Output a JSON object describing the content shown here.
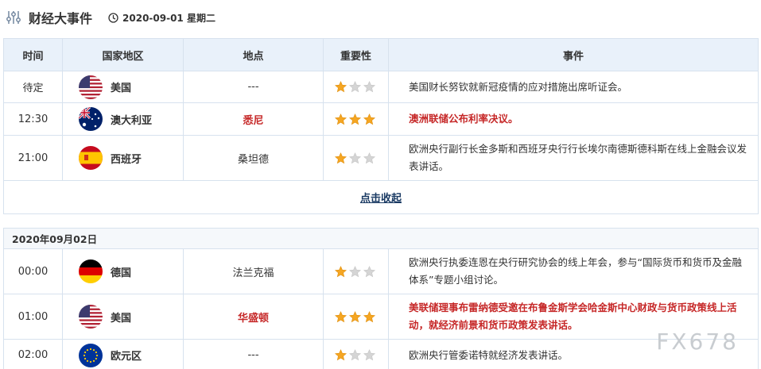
{
  "header": {
    "title": "财经大事件",
    "date": "2020-09-01 星期二"
  },
  "columns": [
    "时间",
    "国家地区",
    "地点",
    "重要性",
    "事件"
  ],
  "day1": [
    {
      "time": "待定",
      "country": "美国",
      "flag": "us-flag-icon",
      "place": "---",
      "importance": 1,
      "event": "美国财长努钦就新冠疫情的应对措施出席听证会。",
      "important": false
    },
    {
      "time": "12:30",
      "country": "澳大利亚",
      "flag": "au-flag-icon",
      "place": "悉尼",
      "importance": 3,
      "event": "澳洲联储公布利率决议。",
      "important": true
    },
    {
      "time": "21:00",
      "country": "西班牙",
      "flag": "es-flag-icon",
      "place": "桑坦德",
      "importance": 1,
      "event": "欧洲央行副行长金多斯和西班牙央行行长埃尔南德斯德科斯在线上金融会议发表讲话。",
      "important": false
    }
  ],
  "collapse_label": "点击收起",
  "day2_label": "2020年09月02日",
  "day2": [
    {
      "time": "00:00",
      "country": "德国",
      "flag": "de-flag-icon",
      "place": "法兰克福",
      "importance": 1,
      "event": "欧洲央行执委连恩在央行研究协会的线上年会，参与“国际货币和货币及金融体系”专题小组讨论。",
      "important": false
    },
    {
      "time": "01:00",
      "country": "美国",
      "flag": "us-flag-icon",
      "place": "华盛顿",
      "importance": 3,
      "event": "美联储理事布雷纳德受邀在布鲁金斯学会哈金斯中心财政与货币政策线上活动，就经济前景和货币政策发表讲话。",
      "important": true
    },
    {
      "time": "02:00",
      "country": "欧元区",
      "flag": "eu-flag-icon",
      "place": "---",
      "importance": 1,
      "event": "欧洲央行管委诺特就经济发表讲话。",
      "important": false
    }
  ],
  "watermark": "FX678",
  "colors": {
    "important": "#c62828",
    "star_on": "#f5a623",
    "star_off": "#d5d5d5",
    "header_bg": "#e9f1fa"
  }
}
